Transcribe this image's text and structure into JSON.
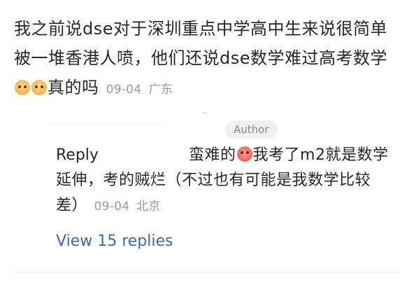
{
  "comment": {
    "text_part1": "我之前说dse对于深圳重点中学高中生来说很简单被一堆香港人喷，他们还说dse数学难过高考数学",
    "emoji_1": "smile-emoji",
    "emoji_2": "smile-emoji",
    "text_part2": "真的吗",
    "date": "09-04",
    "location": "广东"
  },
  "reply": {
    "author_badge": "Author",
    "label": "Reply",
    "text_part1": "蛮难的",
    "emoji": "angry-emoji",
    "text_part2": "我考了m2就是数学延伸，考的贼烂（不过也有可能是我数学比较差）",
    "date": "09-04",
    "location": "北京",
    "view_replies": "View 15 replies"
  },
  "colors": {
    "text": "#262626",
    "meta": "#9a9a9a",
    "link": "#3b6aa8",
    "badge_bg": "#f0f0f0"
  }
}
